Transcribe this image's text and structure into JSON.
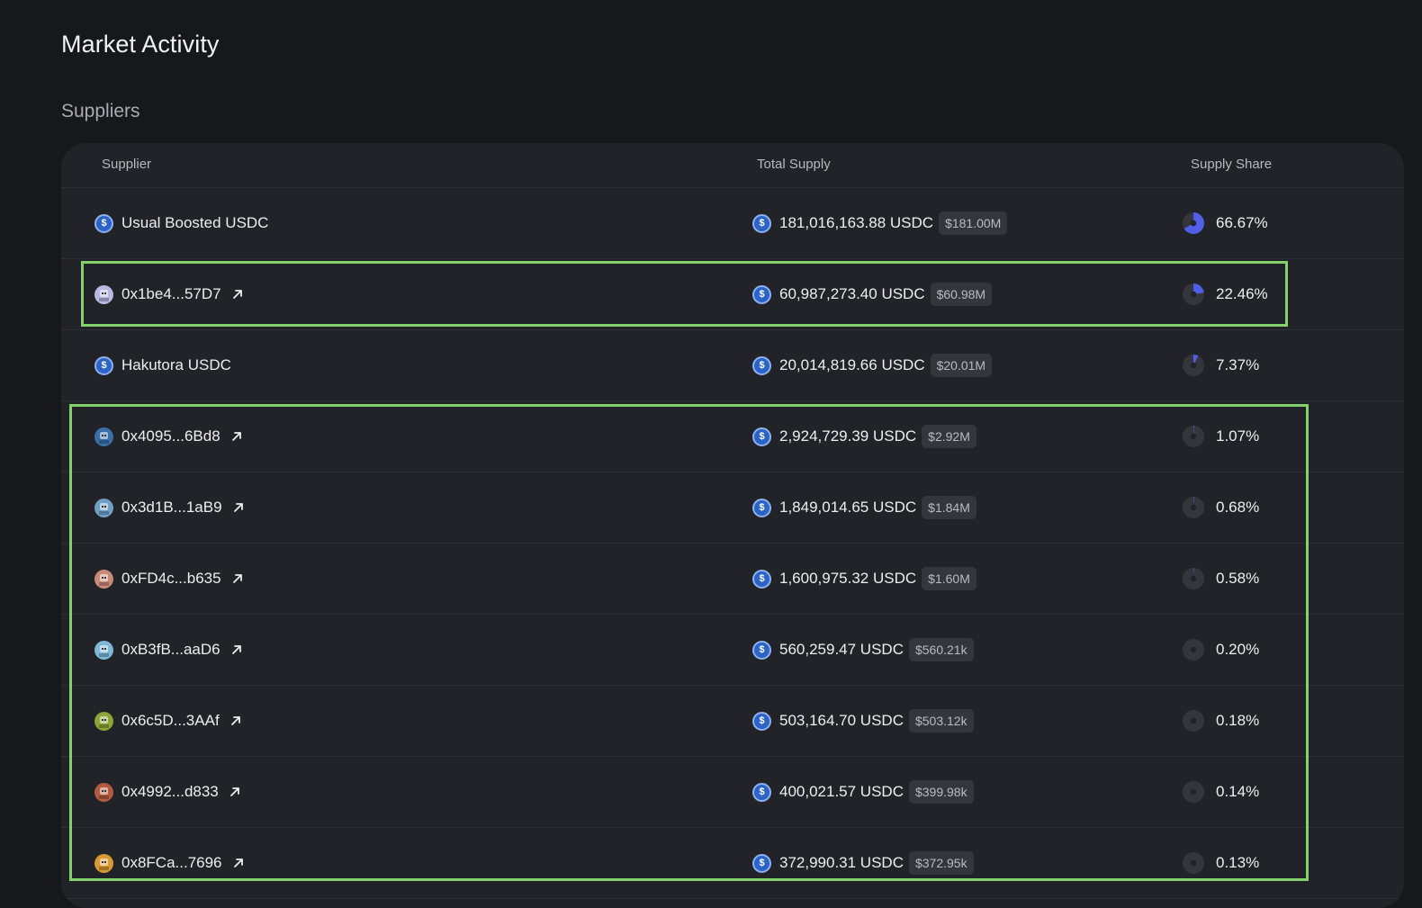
{
  "page": {
    "title": "Market Activity",
    "section_title": "Suppliers"
  },
  "table": {
    "headers": {
      "supplier": "Supplier",
      "total_supply": "Total Supply",
      "supply_share": "Supply Share"
    },
    "rows": [
      {
        "supplier": "Usual Boosted USDC",
        "type": "vault",
        "avatar_icon": "usdc-icon",
        "external_link": false,
        "total": "181,016,163.88 USDC",
        "usd": "$181.00M",
        "share": "66.67%",
        "share_value": 66.67
      },
      {
        "supplier": "0x1be4...57D7",
        "type": "address",
        "avatar_icon": "avatar-icon",
        "avatar_color": "#b7b9e0",
        "external_link": true,
        "total": "60,987,273.40 USDC",
        "usd": "$60.98M",
        "share": "22.46%",
        "share_value": 22.46
      },
      {
        "supplier": "Hakutora USDC",
        "type": "vault",
        "avatar_icon": "usdc-icon",
        "external_link": false,
        "total": "20,014,819.66 USDC",
        "usd": "$20.01M",
        "share": "7.37%",
        "share_value": 7.37
      },
      {
        "supplier": "0x4095...6Bd8",
        "type": "address",
        "avatar_icon": "avatar-icon",
        "avatar_color": "#3b6fa8",
        "external_link": true,
        "total": "2,924,729.39 USDC",
        "usd": "$2.92M",
        "share": "1.07%",
        "share_value": 1.07
      },
      {
        "supplier": "0x3d1B...1aB9",
        "type": "address",
        "avatar_icon": "avatar-icon",
        "avatar_color": "#6f9fc4",
        "external_link": true,
        "total": "1,849,014.65 USDC",
        "usd": "$1.84M",
        "share": "0.68%",
        "share_value": 0.68
      },
      {
        "supplier": "0xFD4c...b635",
        "type": "address",
        "avatar_icon": "avatar-icon",
        "avatar_color": "#c98a78",
        "external_link": true,
        "total": "1,600,975.32 USDC",
        "usd": "$1.60M",
        "share": "0.58%",
        "share_value": 0.58
      },
      {
        "supplier": "0xB3fB...aaD6",
        "type": "address",
        "avatar_icon": "avatar-icon",
        "avatar_color": "#7fb7d9",
        "external_link": true,
        "total": "560,259.47 USDC",
        "usd": "$560.21k",
        "share": "0.20%",
        "share_value": 0.2
      },
      {
        "supplier": "0x6c5D...3AAf",
        "type": "address",
        "avatar_icon": "avatar-icon",
        "avatar_color": "#8fa336",
        "external_link": true,
        "total": "503,164.70 USDC",
        "usd": "$503.12k",
        "share": "0.18%",
        "share_value": 0.18
      },
      {
        "supplier": "0x4992...d833",
        "type": "address",
        "avatar_icon": "avatar-icon",
        "avatar_color": "#b45a3f",
        "external_link": true,
        "total": "400,021.57 USDC",
        "usd": "$399.98k",
        "share": "0.14%",
        "share_value": 0.14
      },
      {
        "supplier": "0x8FCa...7696",
        "type": "address",
        "avatar_icon": "avatar-icon",
        "avatar_color": "#d89a32",
        "external_link": true,
        "total": "372,990.31 USDC",
        "usd": "$372.95k",
        "share": "0.13%",
        "share_value": 0.13
      }
    ]
  },
  "colors": {
    "background": "#17181b",
    "table_background": "#222328",
    "pie_fill": "#4f5fe8",
    "pie_track": "#34363c",
    "usdc_blue": "#2b63c8",
    "highlight_green": "#86d26a"
  },
  "highlights": [
    {
      "label": "highlight-row-2",
      "rows": [
        2
      ]
    },
    {
      "label": "highlight-rows-4-10",
      "rows": [
        4,
        5,
        6,
        7,
        8,
        9,
        10
      ]
    }
  ]
}
